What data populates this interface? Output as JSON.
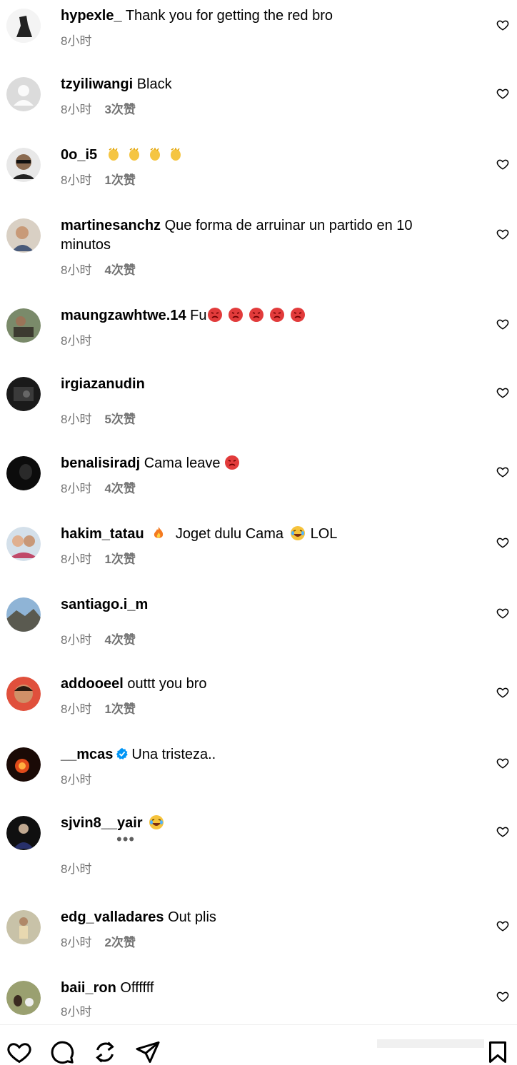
{
  "comments": [
    {
      "username": "hypexle_",
      "text": "Thank you for getting the red bro",
      "time": "8小时",
      "likes": ""
    },
    {
      "username": "tzyiliwangi",
      "text": "Black",
      "time": "8小时",
      "likes": "3次赞"
    },
    {
      "username": "0o_i5",
      "text": "",
      "time": "8小时",
      "likes": "1次赞",
      "emojis": "clapping-hands x4"
    },
    {
      "username": "martinesanchz",
      "text": "Que forma de arruinar un partido en 10",
      "text2": "minutos",
      "time": "8小时",
      "likes": "4次赞"
    },
    {
      "username": "maungzawhtwe.14",
      "text": "Fu",
      "time": "8小时",
      "likes": "",
      "emojis": "angry-face x5"
    },
    {
      "username": "irgiazanudin",
      "text": "",
      "time": "8小时",
      "likes": "5次赞"
    },
    {
      "username": "benalisiradj",
      "text": "Cama leave",
      "time": "8小时",
      "likes": "4次赞",
      "emojis": "angry-face x1"
    },
    {
      "username": "hakim_tatau",
      "text_a": "Joget dulu Cama",
      "text_b": "LOL",
      "time": "8小时",
      "likes": "1次赞",
      "emojis": "fire, laughing-face"
    },
    {
      "username": "santiago.i_m",
      "text": "",
      "time": "8小时",
      "likes": "4次赞"
    },
    {
      "username": "addooeel",
      "text": "outtt you bro",
      "time": "8小时",
      "likes": "1次赞"
    },
    {
      "username": "__mcas",
      "text": "Una tristeza..",
      "time": "8小时",
      "likes": "",
      "verified": true
    },
    {
      "username": "sjvin8__yair",
      "text": "",
      "time": "8小时",
      "likes": "",
      "emojis": "laughing-face",
      "dots": "•••"
    },
    {
      "username": "edg_valladares",
      "text": "Out plis",
      "time": "8小时",
      "likes": "2次赞"
    },
    {
      "username": "baii_ron",
      "text": "Offffff",
      "time": "8小时",
      "likes": ""
    }
  ],
  "colors": {
    "meta": "#737373",
    "verified": "#0095f6",
    "angry": "#e23b3b"
  },
  "bottom_bar": {
    "icons": [
      "heart-icon",
      "comment-icon",
      "repost-icon",
      "share-icon",
      "bookmark-icon"
    ]
  }
}
